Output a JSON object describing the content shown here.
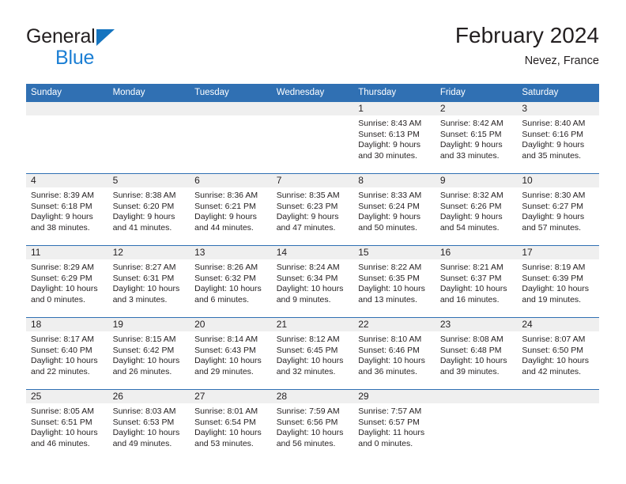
{
  "brand": {
    "name_top": "General",
    "name_bottom": "Blue",
    "mark": "triangle-logo",
    "accent_color": "#1c7fd4"
  },
  "header": {
    "title": "February 2024",
    "subtitle": "Nevez, France"
  },
  "theme": {
    "header_blue": "#3070b3",
    "band_gray": "#efefef",
    "text": "#231f20"
  },
  "weekday_headers": [
    "Sunday",
    "Monday",
    "Tuesday",
    "Wednesday",
    "Thursday",
    "Friday",
    "Saturday"
  ],
  "weeks": [
    [
      {
        "day": "",
        "sunrise": "",
        "sunset": "",
        "daylight_1": "",
        "daylight_2": ""
      },
      {
        "day": "",
        "sunrise": "",
        "sunset": "",
        "daylight_1": "",
        "daylight_2": ""
      },
      {
        "day": "",
        "sunrise": "",
        "sunset": "",
        "daylight_1": "",
        "daylight_2": ""
      },
      {
        "day": "",
        "sunrise": "",
        "sunset": "",
        "daylight_1": "",
        "daylight_2": ""
      },
      {
        "day": "1",
        "sunrise": "Sunrise: 8:43 AM",
        "sunset": "Sunset: 6:13 PM",
        "daylight_1": "Daylight: 9 hours",
        "daylight_2": "and 30 minutes."
      },
      {
        "day": "2",
        "sunrise": "Sunrise: 8:42 AM",
        "sunset": "Sunset: 6:15 PM",
        "daylight_1": "Daylight: 9 hours",
        "daylight_2": "and 33 minutes."
      },
      {
        "day": "3",
        "sunrise": "Sunrise: 8:40 AM",
        "sunset": "Sunset: 6:16 PM",
        "daylight_1": "Daylight: 9 hours",
        "daylight_2": "and 35 minutes."
      }
    ],
    [
      {
        "day": "4",
        "sunrise": "Sunrise: 8:39 AM",
        "sunset": "Sunset: 6:18 PM",
        "daylight_1": "Daylight: 9 hours",
        "daylight_2": "and 38 minutes."
      },
      {
        "day": "5",
        "sunrise": "Sunrise: 8:38 AM",
        "sunset": "Sunset: 6:20 PM",
        "daylight_1": "Daylight: 9 hours",
        "daylight_2": "and 41 minutes."
      },
      {
        "day": "6",
        "sunrise": "Sunrise: 8:36 AM",
        "sunset": "Sunset: 6:21 PM",
        "daylight_1": "Daylight: 9 hours",
        "daylight_2": "and 44 minutes."
      },
      {
        "day": "7",
        "sunrise": "Sunrise: 8:35 AM",
        "sunset": "Sunset: 6:23 PM",
        "daylight_1": "Daylight: 9 hours",
        "daylight_2": "and 47 minutes."
      },
      {
        "day": "8",
        "sunrise": "Sunrise: 8:33 AM",
        "sunset": "Sunset: 6:24 PM",
        "daylight_1": "Daylight: 9 hours",
        "daylight_2": "and 50 minutes."
      },
      {
        "day": "9",
        "sunrise": "Sunrise: 8:32 AM",
        "sunset": "Sunset: 6:26 PM",
        "daylight_1": "Daylight: 9 hours",
        "daylight_2": "and 54 minutes."
      },
      {
        "day": "10",
        "sunrise": "Sunrise: 8:30 AM",
        "sunset": "Sunset: 6:27 PM",
        "daylight_1": "Daylight: 9 hours",
        "daylight_2": "and 57 minutes."
      }
    ],
    [
      {
        "day": "11",
        "sunrise": "Sunrise: 8:29 AM",
        "sunset": "Sunset: 6:29 PM",
        "daylight_1": "Daylight: 10 hours",
        "daylight_2": "and 0 minutes."
      },
      {
        "day": "12",
        "sunrise": "Sunrise: 8:27 AM",
        "sunset": "Sunset: 6:31 PM",
        "daylight_1": "Daylight: 10 hours",
        "daylight_2": "and 3 minutes."
      },
      {
        "day": "13",
        "sunrise": "Sunrise: 8:26 AM",
        "sunset": "Sunset: 6:32 PM",
        "daylight_1": "Daylight: 10 hours",
        "daylight_2": "and 6 minutes."
      },
      {
        "day": "14",
        "sunrise": "Sunrise: 8:24 AM",
        "sunset": "Sunset: 6:34 PM",
        "daylight_1": "Daylight: 10 hours",
        "daylight_2": "and 9 minutes."
      },
      {
        "day": "15",
        "sunrise": "Sunrise: 8:22 AM",
        "sunset": "Sunset: 6:35 PM",
        "daylight_1": "Daylight: 10 hours",
        "daylight_2": "and 13 minutes."
      },
      {
        "day": "16",
        "sunrise": "Sunrise: 8:21 AM",
        "sunset": "Sunset: 6:37 PM",
        "daylight_1": "Daylight: 10 hours",
        "daylight_2": "and 16 minutes."
      },
      {
        "day": "17",
        "sunrise": "Sunrise: 8:19 AM",
        "sunset": "Sunset: 6:39 PM",
        "daylight_1": "Daylight: 10 hours",
        "daylight_2": "and 19 minutes."
      }
    ],
    [
      {
        "day": "18",
        "sunrise": "Sunrise: 8:17 AM",
        "sunset": "Sunset: 6:40 PM",
        "daylight_1": "Daylight: 10 hours",
        "daylight_2": "and 22 minutes."
      },
      {
        "day": "19",
        "sunrise": "Sunrise: 8:15 AM",
        "sunset": "Sunset: 6:42 PM",
        "daylight_1": "Daylight: 10 hours",
        "daylight_2": "and 26 minutes."
      },
      {
        "day": "20",
        "sunrise": "Sunrise: 8:14 AM",
        "sunset": "Sunset: 6:43 PM",
        "daylight_1": "Daylight: 10 hours",
        "daylight_2": "and 29 minutes."
      },
      {
        "day": "21",
        "sunrise": "Sunrise: 8:12 AM",
        "sunset": "Sunset: 6:45 PM",
        "daylight_1": "Daylight: 10 hours",
        "daylight_2": "and 32 minutes."
      },
      {
        "day": "22",
        "sunrise": "Sunrise: 8:10 AM",
        "sunset": "Sunset: 6:46 PM",
        "daylight_1": "Daylight: 10 hours",
        "daylight_2": "and 36 minutes."
      },
      {
        "day": "23",
        "sunrise": "Sunrise: 8:08 AM",
        "sunset": "Sunset: 6:48 PM",
        "daylight_1": "Daylight: 10 hours",
        "daylight_2": "and 39 minutes."
      },
      {
        "day": "24",
        "sunrise": "Sunrise: 8:07 AM",
        "sunset": "Sunset: 6:50 PM",
        "daylight_1": "Daylight: 10 hours",
        "daylight_2": "and 42 minutes."
      }
    ],
    [
      {
        "day": "25",
        "sunrise": "Sunrise: 8:05 AM",
        "sunset": "Sunset: 6:51 PM",
        "daylight_1": "Daylight: 10 hours",
        "daylight_2": "and 46 minutes."
      },
      {
        "day": "26",
        "sunrise": "Sunrise: 8:03 AM",
        "sunset": "Sunset: 6:53 PM",
        "daylight_1": "Daylight: 10 hours",
        "daylight_2": "and 49 minutes."
      },
      {
        "day": "27",
        "sunrise": "Sunrise: 8:01 AM",
        "sunset": "Sunset: 6:54 PM",
        "daylight_1": "Daylight: 10 hours",
        "daylight_2": "and 53 minutes."
      },
      {
        "day": "28",
        "sunrise": "Sunrise: 7:59 AM",
        "sunset": "Sunset: 6:56 PM",
        "daylight_1": "Daylight: 10 hours",
        "daylight_2": "and 56 minutes."
      },
      {
        "day": "29",
        "sunrise": "Sunrise: 7:57 AM",
        "sunset": "Sunset: 6:57 PM",
        "daylight_1": "Daylight: 11 hours",
        "daylight_2": "and 0 minutes."
      },
      {
        "day": "",
        "sunrise": "",
        "sunset": "",
        "daylight_1": "",
        "daylight_2": ""
      },
      {
        "day": "",
        "sunrise": "",
        "sunset": "",
        "daylight_1": "",
        "daylight_2": ""
      }
    ]
  ]
}
